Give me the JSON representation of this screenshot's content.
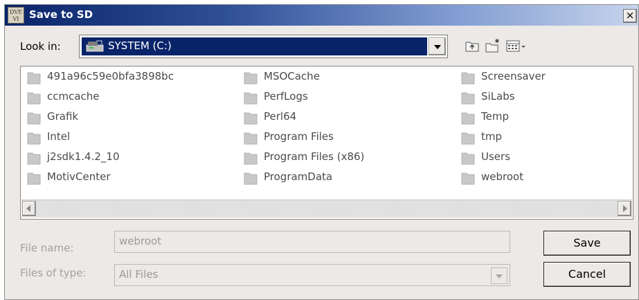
{
  "window": {
    "title": "Save to SD",
    "app_icon_text": "DVE\nVI",
    "close_glyph": "×"
  },
  "look_in": {
    "label": "Look in:",
    "value": "SYSTEM (C:)"
  },
  "toolbar": {
    "icons": [
      "up-folder-icon",
      "new-folder-icon",
      "view-menu-icon"
    ]
  },
  "files": {
    "columns": [
      [
        "491a96c59e0bfa3898bc",
        "ccmcache",
        "Grafik",
        "Intel",
        "j2sdk1.4.2_10",
        "MotivCenter"
      ],
      [
        "MSOCache",
        "PerfLogs",
        "Perl64",
        "Program Files",
        "Program Files (x86)",
        "ProgramData"
      ],
      [
        "Screensaver",
        "SiLabs",
        "Temp",
        "tmp",
        "Users",
        "webroot"
      ]
    ]
  },
  "file_name": {
    "label": "File name:",
    "value": "webroot"
  },
  "file_type": {
    "label": "Files of type:",
    "value": "All Files"
  },
  "buttons": {
    "save": "Save",
    "cancel": "Cancel"
  },
  "colors": {
    "title_gradient_start": "#0a246a",
    "selection": "#0a246a",
    "dialog_bg": "#ece9e6",
    "folder": "#c8c8c8"
  }
}
